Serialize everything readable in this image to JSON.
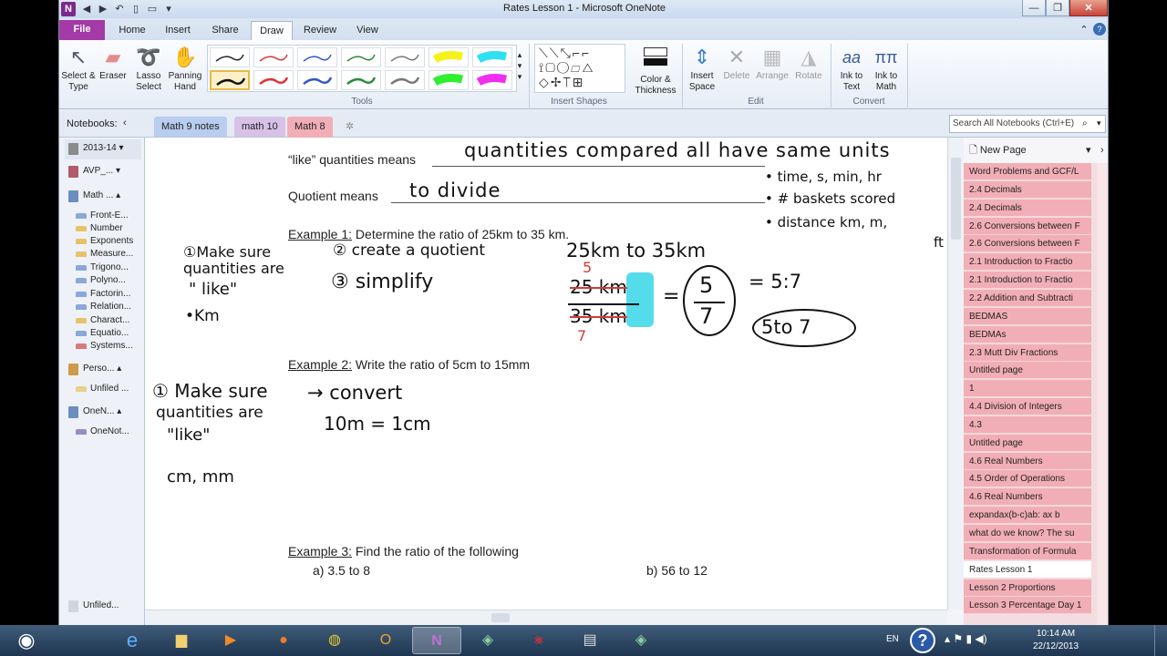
{
  "window": {
    "title": "Rates Lesson 1 - Microsoft OneNote",
    "app_icon": "N"
  },
  "ribbon_tabs": [
    "File",
    "Home",
    "Insert",
    "Share",
    "Draw",
    "Review",
    "View"
  ],
  "ribbon": {
    "select": "Select & Type",
    "eraser": "Eraser",
    "lasso": "Lasso Select",
    "panning": "Panning Hand",
    "tools_group": "Tools",
    "insert_shapes_group": "Insert Shapes",
    "color_thickness": "Color & Thickness",
    "insert_space": "Insert Space",
    "delete": "Delete",
    "arrange": "Arrange",
    "rotate": "Rotate",
    "edit_group": "Edit",
    "ink_to_text": "Ink to Text",
    "ink_to_math": "Ink to Math",
    "convert_group": "Convert"
  },
  "nav": {
    "notebooks_label": "Notebooks:",
    "section_tabs": [
      "Math 9 notes",
      "math 10",
      "Math 8"
    ],
    "search_placeholder": "Search All Notebooks (Ctrl+E)"
  },
  "notebooks": [
    {
      "name": "2013-14",
      "color": "#8a8a8a"
    },
    {
      "name": "AVP_...",
      "color": "#b05a6a"
    },
    {
      "name": "Math ...",
      "color": "#6a8ec0"
    }
  ],
  "sections": [
    {
      "name": "Front-E...",
      "color": "#8aa8d8"
    },
    {
      "name": "Number",
      "color": "#e8c26a"
    },
    {
      "name": "Exponents",
      "color": "#e8c26a"
    },
    {
      "name": "Measure...",
      "color": "#e8c26a"
    },
    {
      "name": "Trigono...",
      "color": "#8aa8d8"
    },
    {
      "name": "Polyno...",
      "color": "#8aa8d8"
    },
    {
      "name": "Factorin...",
      "color": "#8aa8d8"
    },
    {
      "name": "Relation...",
      "color": "#8aa8d8"
    },
    {
      "name": "Charact...",
      "color": "#e8c26a"
    },
    {
      "name": "Equatio...",
      "color": "#8aa8d8"
    },
    {
      "name": "Systems...",
      "color": "#d87a7a"
    }
  ],
  "other_notebooks": [
    {
      "name": "Perso...",
      "section": "Unfiled ..."
    },
    {
      "name": "OneN...",
      "section": "OneNot..."
    }
  ],
  "unfiled_bottom": "Unfiled...",
  "page": {
    "line1_label": "“like” quantities means",
    "line2_label": "Quotient means",
    "ex1_label": "Example 1:",
    "ex1_text": " Determine the ratio of 25km to 35 km.",
    "ex2_label": "Example 2:",
    "ex2_text": "  Write the ratio of 5cm to 15mm",
    "ex3_label": "Example 3:",
    "ex3_text": " Find the ratio of the following",
    "ex3_a": "a)    3.5 to 8",
    "ex3_b": "b)    56 to 12"
  },
  "ink": {
    "line1": "quantities compared all have same units",
    "line2": "to divide",
    "units": [
      "• time, s, min, hr",
      "• # baskets scored",
      "• distance km, m,",
      "ft"
    ],
    "step1": [
      "①Make sure",
      "quantities are",
      "\" like\"",
      "•Km"
    ],
    "step2": "② create a quotient",
    "step3": "③ simplify",
    "ratio_title": "25km to 35km",
    "num": "25 km",
    "den": "35 km",
    "red_top": "5",
    "red_bottom": "7",
    "frac_top": "5",
    "frac_bottom": "7",
    "ratio": "= 5:7",
    "ratio_words": "5to 7",
    "ex2_step": [
      "① Make sure",
      "quantities are",
      "\"like\"",
      "cm, mm"
    ],
    "convert": "→ convert",
    "conv_eq": "10m = 1cm"
  },
  "pages": [
    "New Page",
    "Word Problems and GCF/L",
    "2.4 Decimals",
    "2.4 Decimals",
    "2.6 Conversions between F",
    "2.6 Conversions between F",
    "2.1 Introduction to Fractio",
    "2.1 Introduction to Fractio",
    "2.2 Addition and Subtracti",
    "BEDMAS",
    "BEDMAs",
    "2.3 Mutt Div Fractions",
    "Untitled page",
    "1",
    "4.4 Division of Integers",
    "4.3",
    "Untitled page",
    "4.6 Real Numbers",
    "4.5 Order of Operations",
    "4.6 Real Numbers",
    "expandax(b-c)ab: ax b",
    "what do we know? The su",
    "Transformation of Formula",
    "Rates Lesson 1",
    "Lesson 2 Proportions",
    "Lesson 3 Percentage Day 1"
  ],
  "selected_page": "Rates Lesson 1",
  "taskbar": {
    "lang": "EN",
    "time": "10:14 AM",
    "date": "22/12/2013"
  },
  "colors": {
    "accent_file": "#a33aa6",
    "page_tab_bg": "#f2aeb6",
    "ink_red": "#d43a3a",
    "highlight_cyan": "#37d6e8"
  }
}
